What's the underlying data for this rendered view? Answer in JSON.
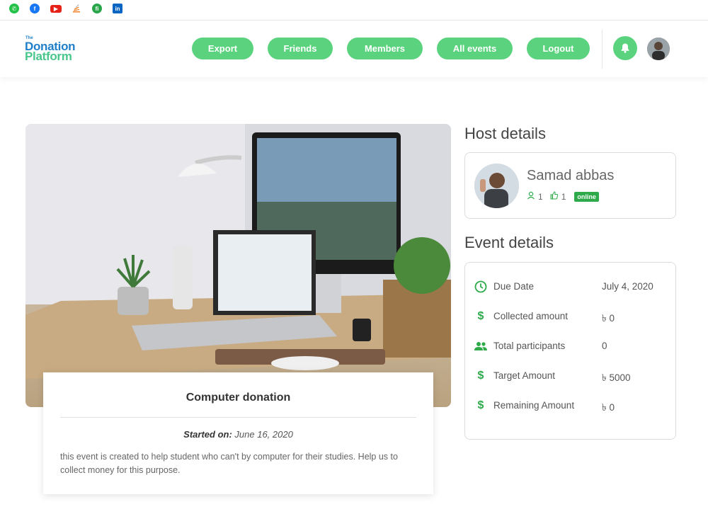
{
  "social": [
    "whatsapp-icon",
    "facebook-icon",
    "youtube-icon",
    "stackoverflow-icon",
    "fiverr-icon",
    "linkedin-icon"
  ],
  "logo": {
    "the": "The",
    "line1": "Donation",
    "line2": "Platform"
  },
  "nav": {
    "export": "Export",
    "friends": "Friends",
    "members": "Members",
    "all_events": "All events",
    "logout": "Logout"
  },
  "event": {
    "title": "Computer donation",
    "started_label": "Started on:",
    "started_date": "June 16, 2020",
    "description": "this event is created to help student who can't by computer for their studies. Help us to collect money for this purpose."
  },
  "host": {
    "section_title": "Host details",
    "name": "Samad abbas",
    "followers": "1",
    "likes": "1",
    "status": "online"
  },
  "details": {
    "section_title": "Event details",
    "rows": [
      {
        "icon": "clock-icon",
        "label": "Due Date",
        "value": "July 4, 2020"
      },
      {
        "icon": "dollar-icon",
        "label": "Collected amount",
        "value": "৳ 0"
      },
      {
        "icon": "people-icon",
        "label": "Total participants",
        "value": "0"
      },
      {
        "icon": "dollar-icon",
        "label": "Target Amount",
        "value": "৳ 5000"
      },
      {
        "icon": "dollar-icon",
        "label": "Remaining Amount",
        "value": "৳ 0"
      }
    ]
  },
  "colors": {
    "accent": "#5bd37e",
    "green_dark": "#2eaa4a",
    "brand_blue": "#1f7fc8"
  }
}
